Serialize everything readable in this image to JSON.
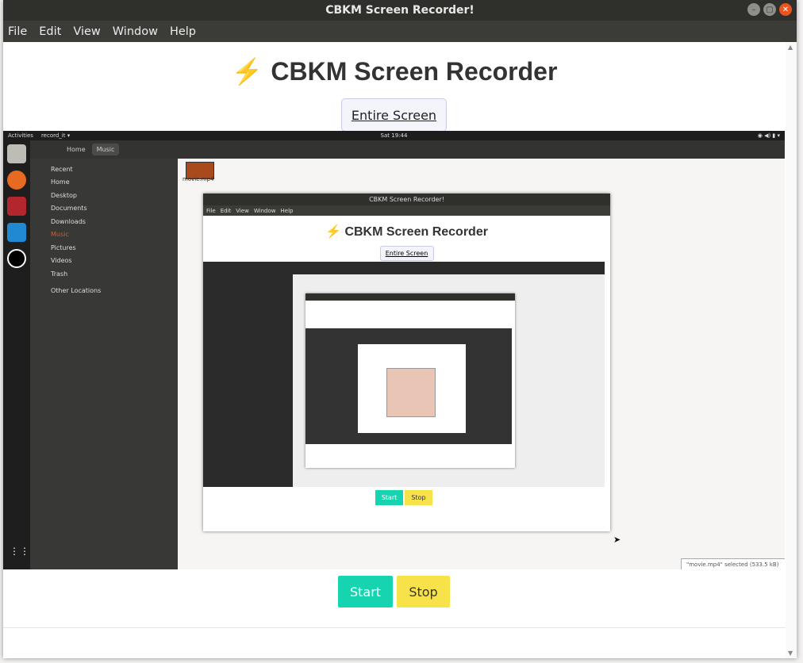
{
  "window": {
    "title": "CBKM Screen Recorder!"
  },
  "menu": [
    "File",
    "Edit",
    "View",
    "Window",
    "Help"
  ],
  "app": {
    "bolt": "⚡",
    "heading": "CBKM Screen Recorder",
    "source_button": "Entire Screen",
    "start_label": "Start",
    "stop_label": "Stop"
  },
  "preview": {
    "topbar": {
      "activities": "Activities",
      "app": "record_it ▾",
      "clock": "Sat 19:44"
    },
    "breadcrumb": {
      "home": "Home",
      "current": "Music"
    },
    "sidebar": [
      "Recent",
      "Home",
      "Desktop",
      "Documents",
      "Downloads",
      "Music",
      "Pictures",
      "Videos",
      "Trash",
      "Other Locations"
    ],
    "file": "movie.mp4",
    "status": "\"movie.mp4\" selected (533.5 kB)",
    "nested": {
      "title": "CBKM Screen Recorder!",
      "menu": [
        "File",
        "Edit",
        "View",
        "Window",
        "Help"
      ],
      "heading": "CBKM Screen Recorder",
      "button": "Entire Screen",
      "start": "Start",
      "stop": "Stop"
    }
  },
  "colors": {
    "start": "#17d4b0",
    "stop": "#f7e24a",
    "close": "#e9541f"
  }
}
